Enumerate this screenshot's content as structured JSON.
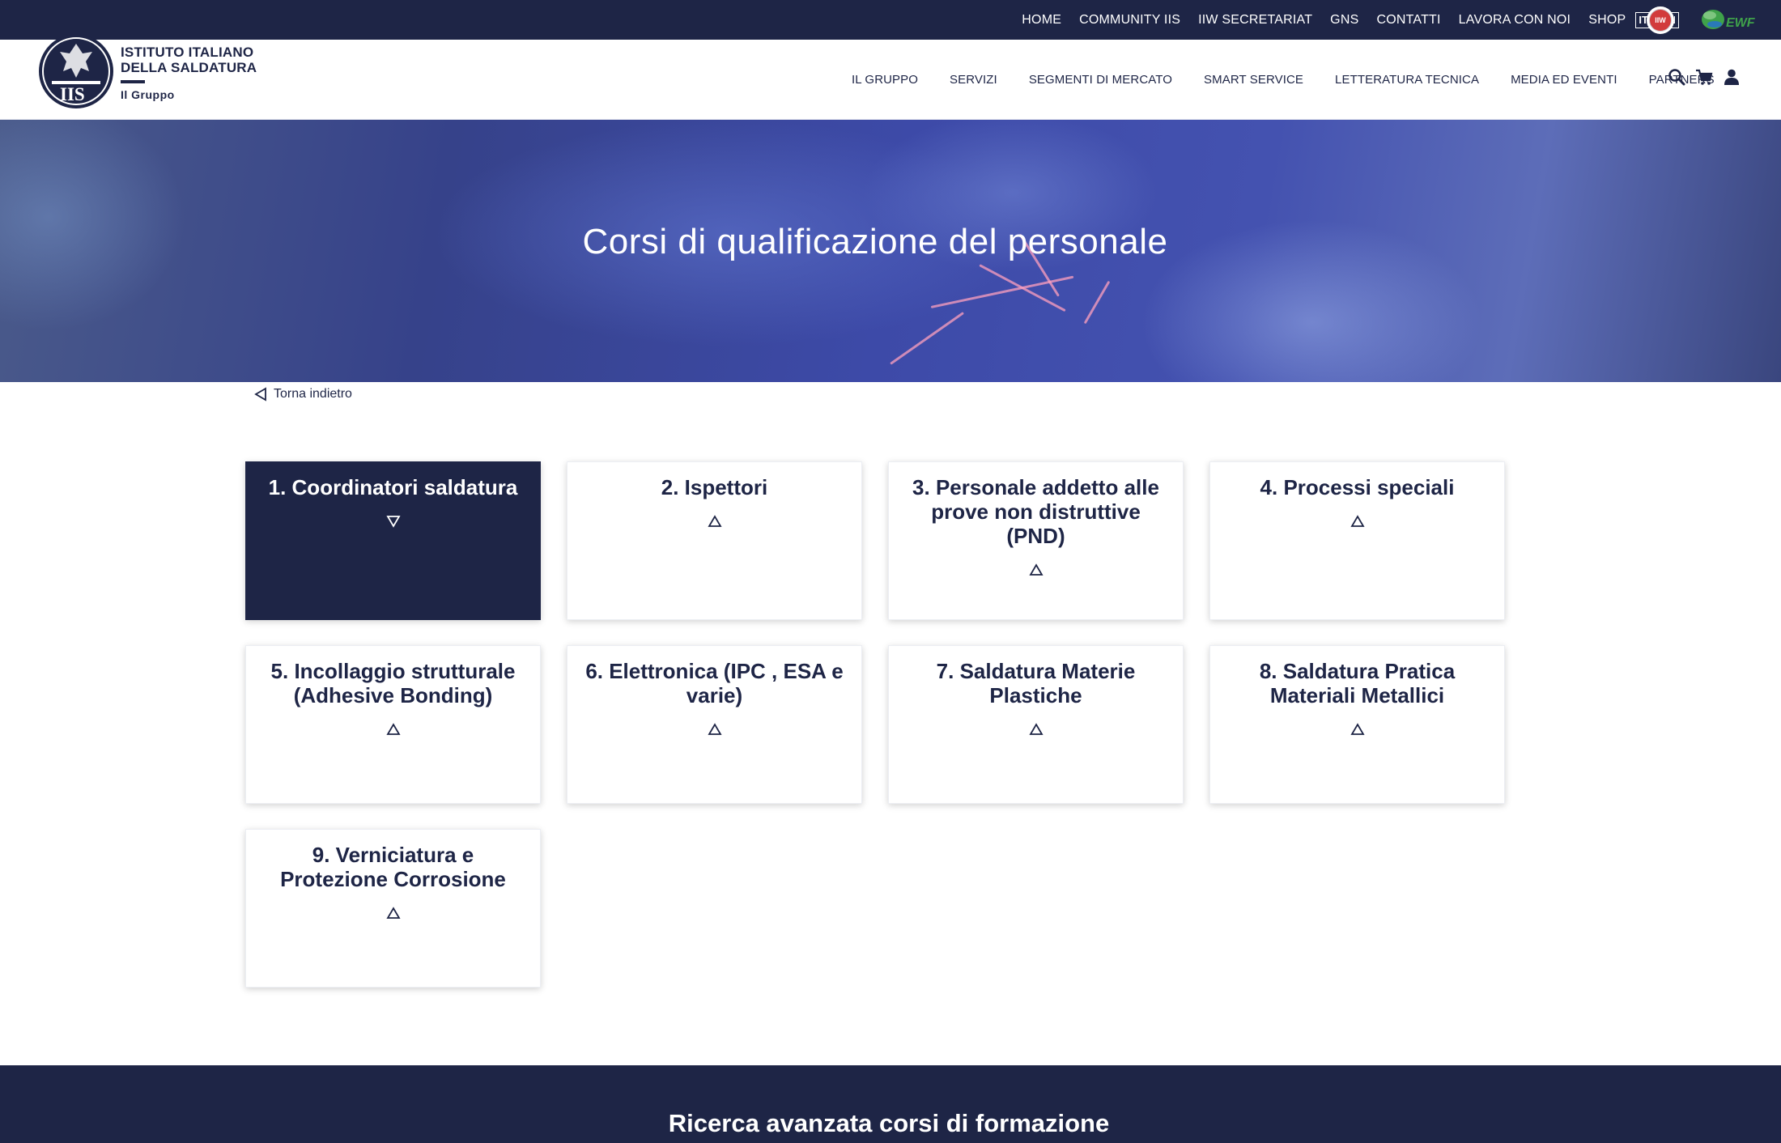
{
  "topbar": {
    "links": [
      "HOME",
      "COMMUNITY IIS",
      "IIW SECRETARIAT",
      "GNS",
      "CONTATTI",
      "LAVORA CON NOI",
      "SHOP"
    ],
    "languages": [
      {
        "label": "IT",
        "active": true
      },
      {
        "label": "EN",
        "active": false
      }
    ],
    "partner_logos": [
      {
        "icon": "iiw-logo",
        "text": "IIW"
      },
      {
        "icon": "ewf-logo",
        "text": "EWF"
      }
    ]
  },
  "header": {
    "logo": {
      "line1": "ISTITUTO ITALIANO",
      "line2": "DELLA SALDATURA",
      "subtitle": "Il Gruppo",
      "emblem_text": "IIS"
    },
    "nav": [
      "IL GRUPPO",
      "SERVIZI",
      "SEGMENTI DI MERCATO",
      "SMART SERVICE",
      "LETTERATURA TECNICA",
      "MEDIA ED EVENTI",
      "PARTNERS"
    ],
    "icons": [
      "search-icon",
      "cart-icon",
      "user-icon"
    ]
  },
  "hero": {
    "title": "Corsi di qualificazione del personale"
  },
  "back_link": {
    "label": "Torna indietro",
    "icon": "back-triangle-icon"
  },
  "cards": [
    {
      "title": "1. Coordinatori saldatura",
      "expanded": true
    },
    {
      "title": "2. Ispettori",
      "expanded": false
    },
    {
      "title": "3. Personale addetto alle prove non distruttive (PND)",
      "expanded": false
    },
    {
      "title": "4. Processi speciali",
      "expanded": false
    },
    {
      "title": "5. Incollaggio strutturale (Adhesive Bonding)",
      "expanded": false
    },
    {
      "title": "6. Elettronica (IPC , ESA e varie)",
      "expanded": false
    },
    {
      "title": "7. Saldatura Materie Plastiche",
      "expanded": false
    },
    {
      "title": "8. Saldatura Pratica Materiali Metallici",
      "expanded": false
    },
    {
      "title": "9. Verniciatura e Protezione Corrosione",
      "expanded": false
    }
  ],
  "footer": {
    "title": "Ricerca avanzata corsi di formazione"
  },
  "colors": {
    "brand_navy": "#1e2546",
    "white": "#ffffff",
    "iiw_red": "#d23b3b",
    "ewf_green": "#3fa24a"
  }
}
